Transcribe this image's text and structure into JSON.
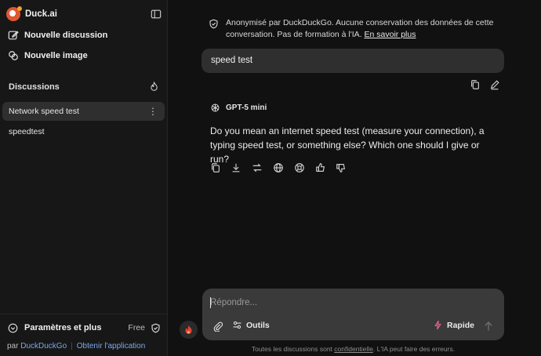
{
  "app": {
    "brand": "Duck.ai"
  },
  "sidebar": {
    "new_chat": "Nouvelle discussion",
    "new_image": "Nouvelle image",
    "section_title": "Discussions",
    "conversations": [
      {
        "label": "Network speed test",
        "active": true
      },
      {
        "label": "speedtest",
        "active": false
      }
    ],
    "settings": {
      "label": "Paramètres et plus",
      "plan": "Free"
    },
    "byline": {
      "prefix": "par",
      "company": "DuckDuckGo",
      "separator": "|",
      "get_app": "Obtenir l'application"
    }
  },
  "notice": {
    "text": "Anonymisé par DuckDuckGo. Aucune conservation des données de cette conversation. Pas de formation à l'IA.",
    "link": "En savoir plus"
  },
  "chat": {
    "user_message": "speed test",
    "model_name": "GPT-5 mini",
    "assistant_message": "Do you mean an internet speed test (measure your connection), a typing speed test, or something else? Which one should I give or run?"
  },
  "composer": {
    "placeholder": "Répondre...",
    "tools_label": "Outils",
    "mode_label": "Rapide"
  },
  "disclaimer": {
    "before": "Toutes les discussions sont",
    "link": "confidentielle",
    "after": ". L'IA peut faire des erreurs."
  },
  "colors": {
    "brand": "#de5833",
    "accent_link": "#7aa7f0",
    "bolt": "#e56a8a",
    "fire": "#e0443a"
  }
}
